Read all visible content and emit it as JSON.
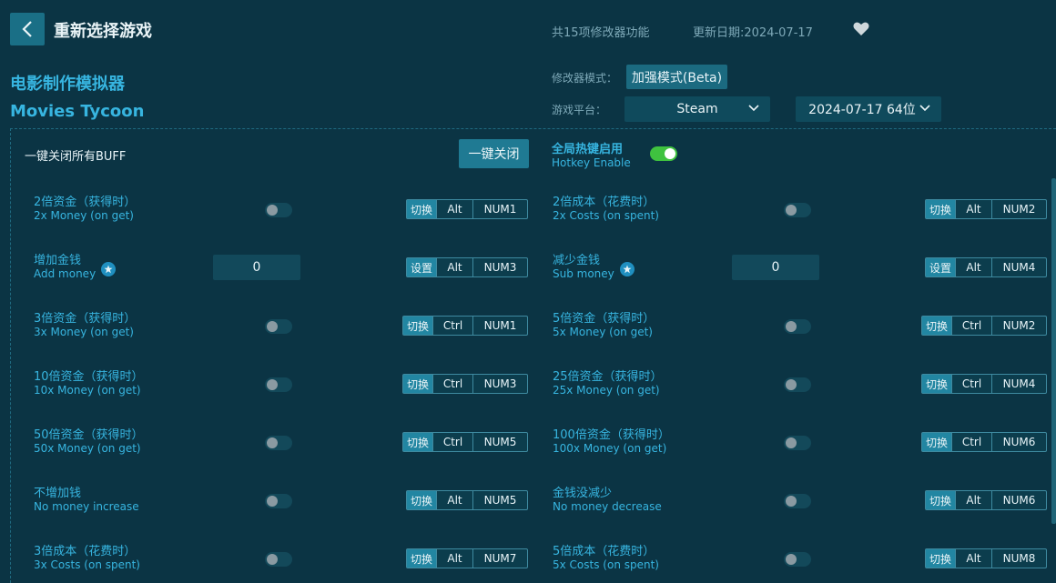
{
  "header": {
    "title": "重新选择游戏",
    "feature_count": "共15项修改器功能",
    "update_date": "更新日期:2024-07-17"
  },
  "game": {
    "name_cn": "电影制作模拟器",
    "name_en": "Movies Tycoon"
  },
  "settings": {
    "mode_label": "修改器模式：",
    "mode_value": "加强模式(Beta)",
    "platform_label": "游戏平台：",
    "platform_value": "Steam",
    "version_value": "2024-07-17 64位"
  },
  "controls": {
    "all_off_label": "一键关闭所有BUFF",
    "all_off_button": "一键关闭",
    "hotkey_cn": "全局热键启用",
    "hotkey_en": "Hotkey Enable",
    "hotkey_enabled": true
  },
  "cheats": [
    {
      "cn": "2倍资金（获得时）",
      "en": "2x Money (on get)",
      "type": "toggle",
      "action": "切换",
      "mod": "Alt",
      "key": "NUM1"
    },
    {
      "cn": "2倍成本（花费时）",
      "en": "2x Costs (on spent)",
      "type": "toggle",
      "action": "切换",
      "mod": "Alt",
      "key": "NUM2"
    },
    {
      "cn": "增加金钱",
      "en": "Add money",
      "type": "input",
      "value": "0",
      "action": "设置",
      "mod": "Alt",
      "key": "NUM3"
    },
    {
      "cn": "减少金钱",
      "en": "Sub money",
      "type": "input",
      "value": "0",
      "action": "设置",
      "mod": "Alt",
      "key": "NUM4"
    },
    {
      "cn": "3倍资金（获得时）",
      "en": "3x Money (on get)",
      "type": "toggle",
      "action": "切换",
      "mod": "Ctrl",
      "key": "NUM1"
    },
    {
      "cn": "5倍资金（获得时）",
      "en": "5x Money (on get)",
      "type": "toggle",
      "action": "切换",
      "mod": "Ctrl",
      "key": "NUM2"
    },
    {
      "cn": "10倍资金（获得时）",
      "en": "10x Money (on get)",
      "type": "toggle",
      "action": "切换",
      "mod": "Ctrl",
      "key": "NUM3"
    },
    {
      "cn": "25倍资金（获得时）",
      "en": "25x Money (on get)",
      "type": "toggle",
      "action": "切换",
      "mod": "Ctrl",
      "key": "NUM4"
    },
    {
      "cn": "50倍资金（获得时）",
      "en": "50x Money (on get)",
      "type": "toggle",
      "action": "切换",
      "mod": "Ctrl",
      "key": "NUM5"
    },
    {
      "cn": "100倍资金（获得时）",
      "en": "100x Money (on get)",
      "type": "toggle",
      "action": "切换",
      "mod": "Ctrl",
      "key": "NUM6"
    },
    {
      "cn": "不增加钱",
      "en": "No money increase",
      "type": "toggle",
      "action": "切换",
      "mod": "Alt",
      "key": "NUM5"
    },
    {
      "cn": "金钱没减少",
      "en": "No money decrease",
      "type": "toggle",
      "action": "切换",
      "mod": "Alt",
      "key": "NUM6"
    },
    {
      "cn": "3倍成本（花费时）",
      "en": "3x Costs (on spent)",
      "type": "toggle",
      "action": "切换",
      "mod": "Alt",
      "key": "NUM7"
    },
    {
      "cn": "5倍成本（花费时）",
      "en": "5x Costs (on spent)",
      "type": "toggle",
      "action": "切换",
      "mod": "Alt",
      "key": "NUM8"
    }
  ]
}
